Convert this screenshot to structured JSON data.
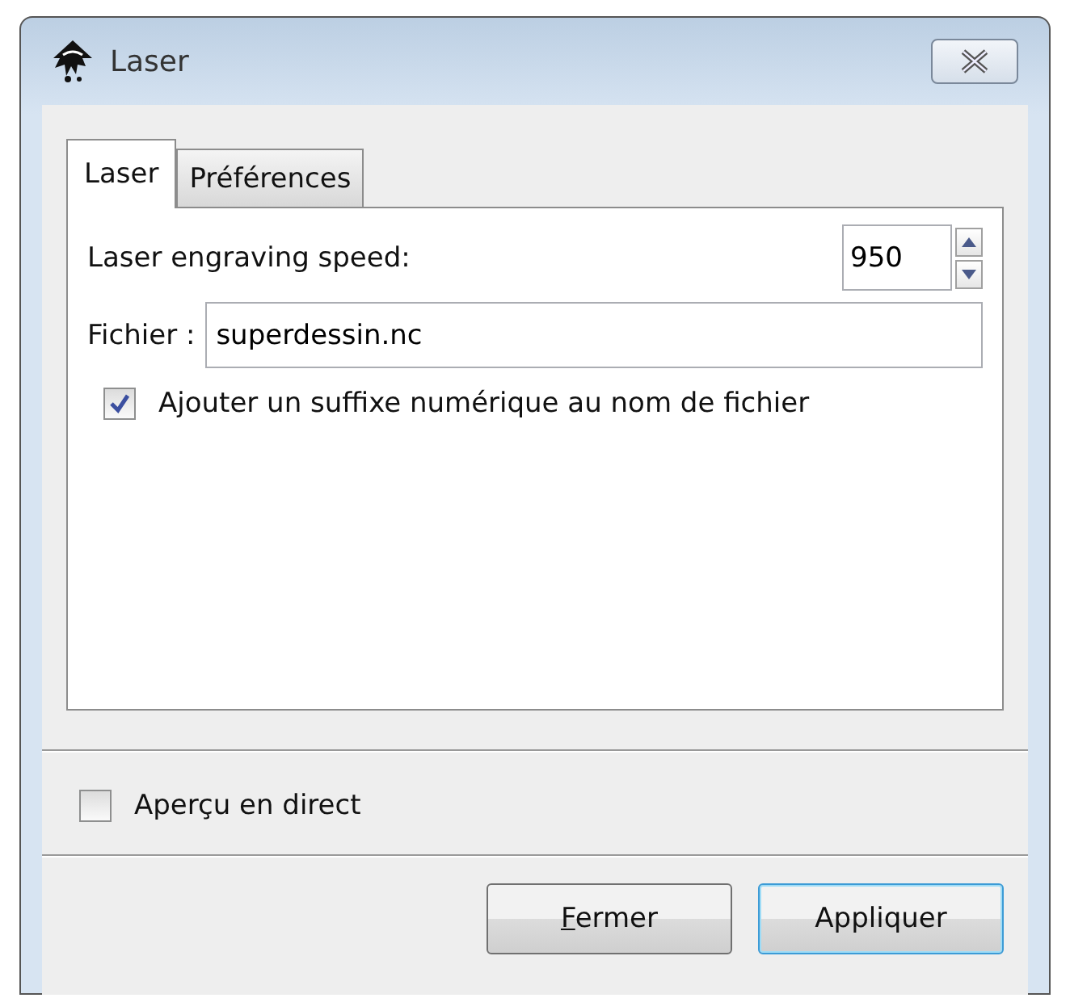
{
  "window": {
    "title": "Laser"
  },
  "tabs": [
    {
      "label": "Laser",
      "selected": true
    },
    {
      "label": "Préférences",
      "selected": false
    }
  ],
  "speed": {
    "label": "Laser engraving speed:",
    "value": "950"
  },
  "file": {
    "label": "Fichier :",
    "value": "superdessin.nc"
  },
  "suffix": {
    "label": "Ajouter un suffixe numérique au nom de fichier",
    "checked": true
  },
  "preview": {
    "label": "Aperçu en direct",
    "checked": false
  },
  "buttons": [
    {
      "label": "Fermer",
      "default": false,
      "mnemonic_first": true
    },
    {
      "label": "Appliquer",
      "default": true,
      "mnemonic_first": false
    }
  ]
}
